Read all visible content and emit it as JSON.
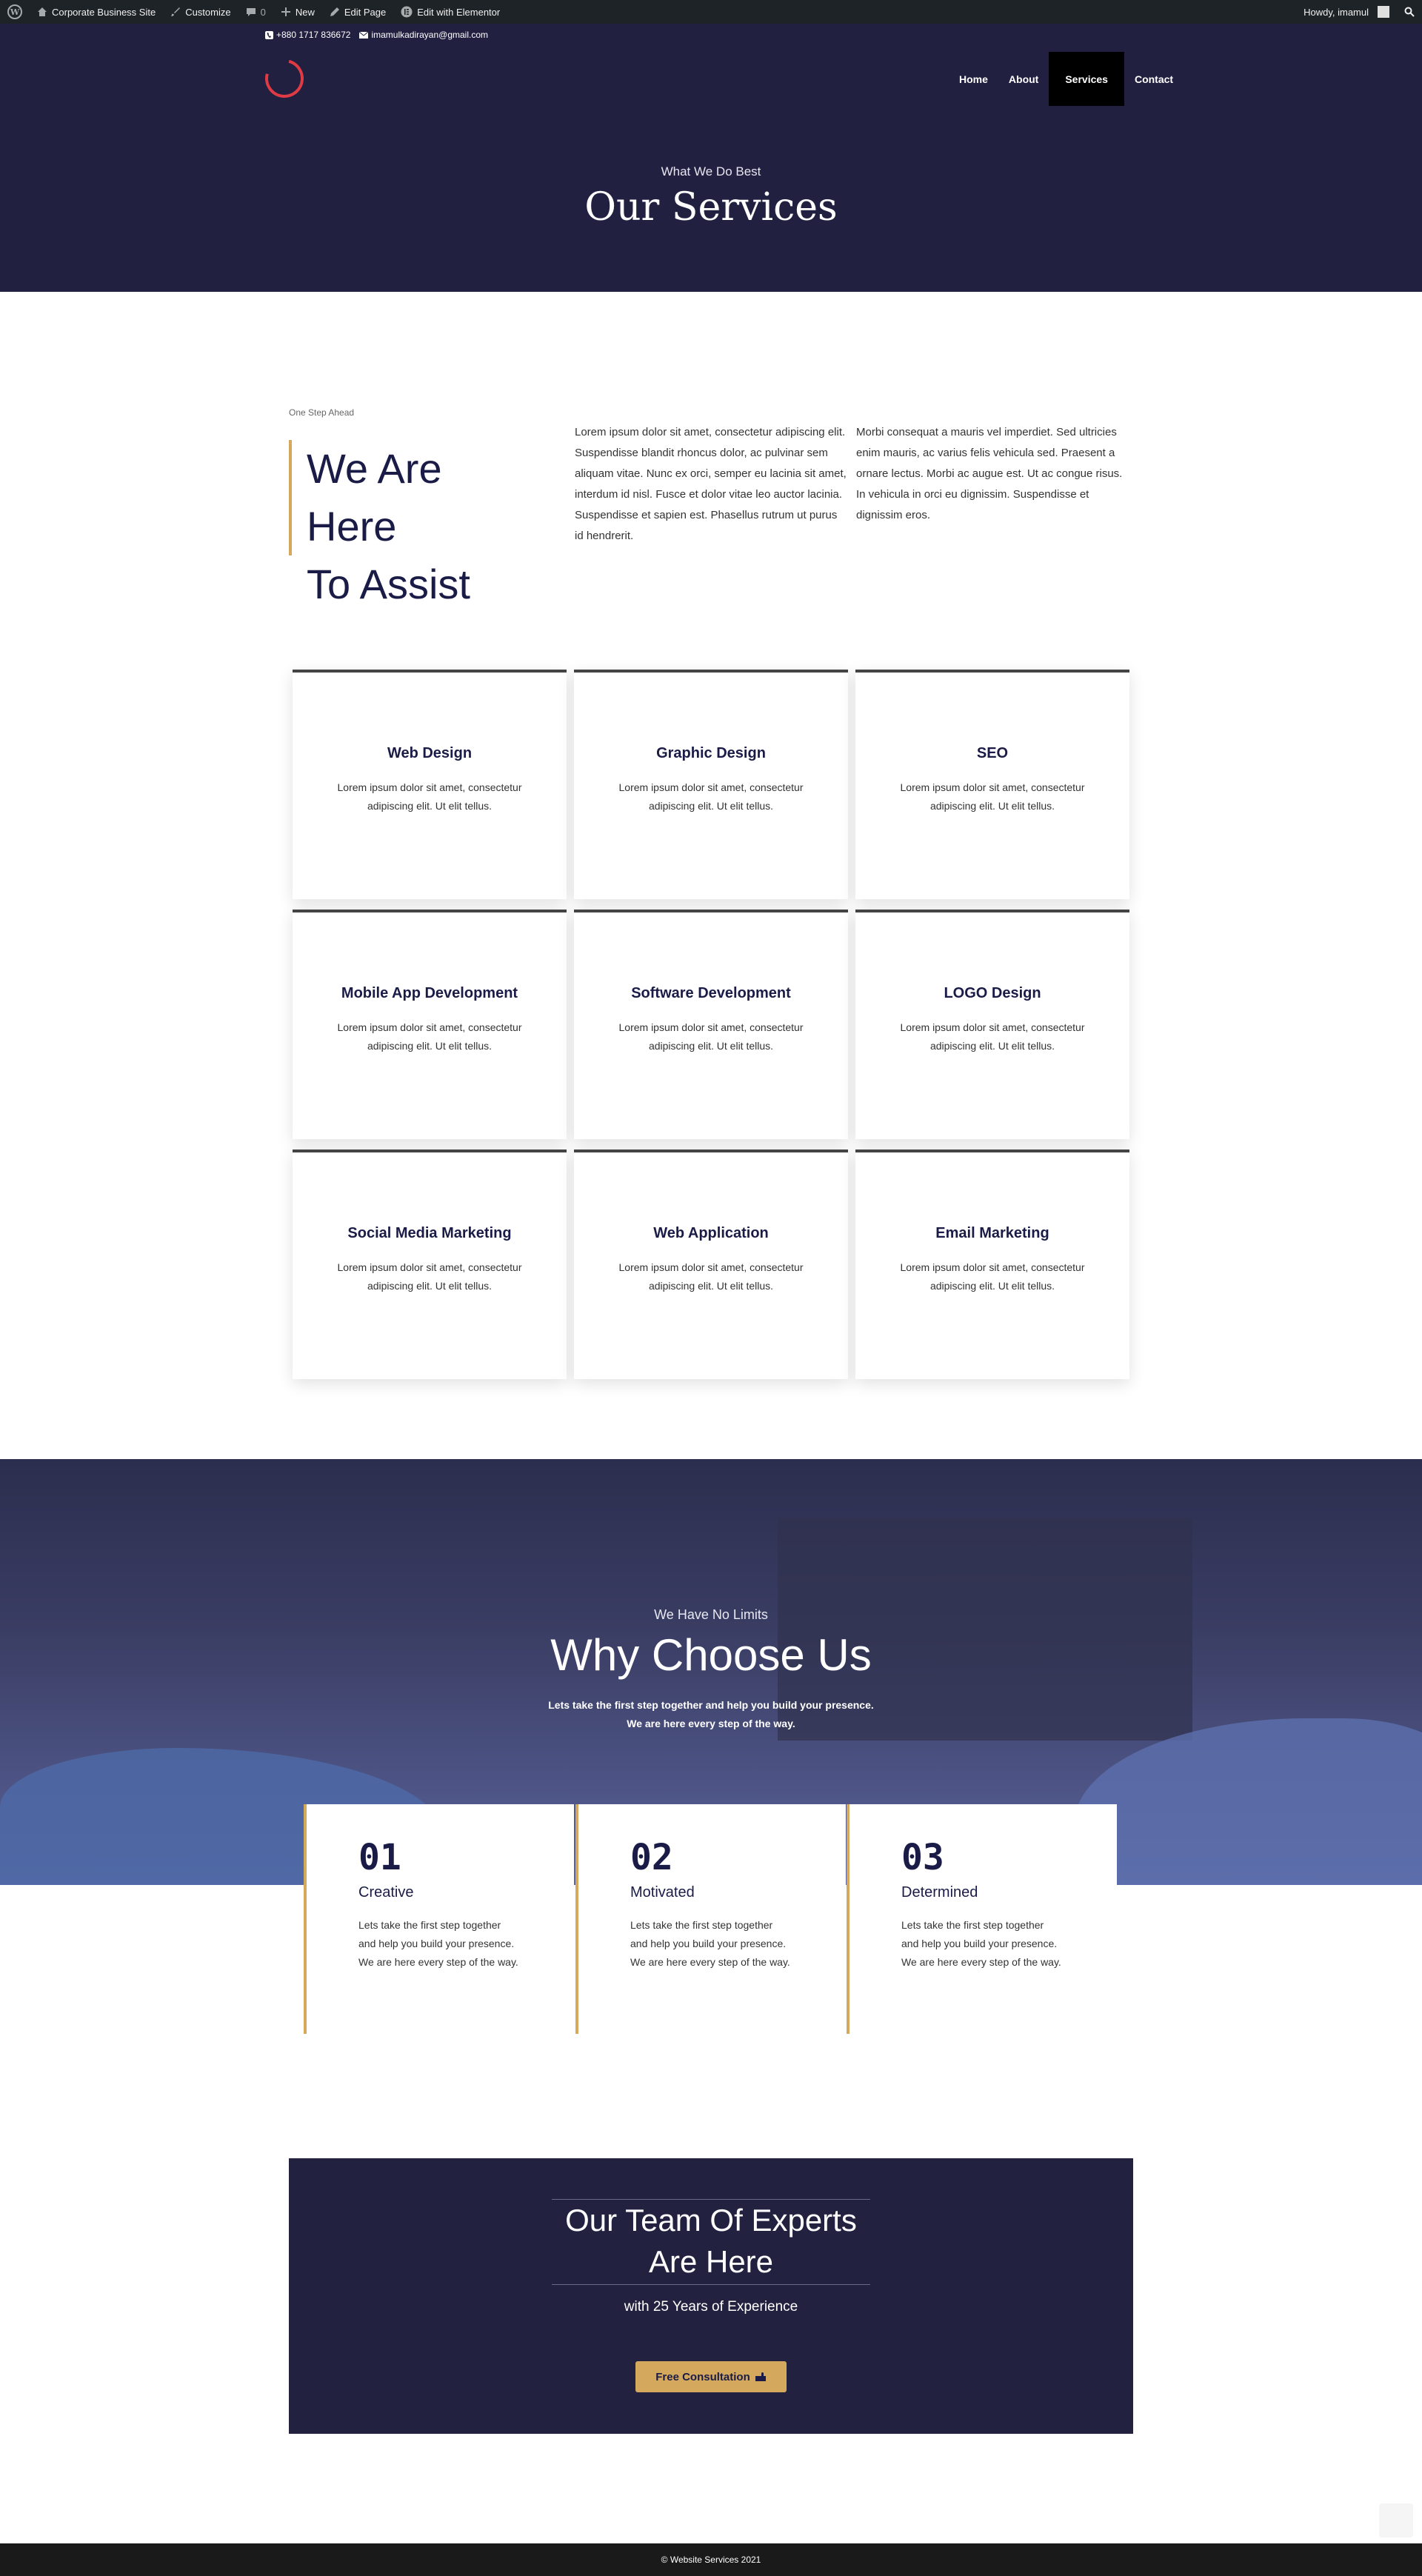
{
  "admin_bar": {
    "site_name": "Corporate Business Site",
    "customize": "Customize",
    "comments_count": "0",
    "new": "New",
    "edit_page": "Edit Page",
    "edit_elementor": "Edit with Elementor",
    "howdy": "Howdy, imamul"
  },
  "header": {
    "phone": "+880 1717 836672",
    "email": "imamulkadirayan@gmail.com",
    "nav": [
      "Home",
      "About",
      "Services",
      "Contact"
    ],
    "active_nav": "Services",
    "subtitle": "What We Do Best",
    "title": "Our Services"
  },
  "intro": {
    "kicker": "One Step Ahead",
    "heading_line1": "We Are Here",
    "heading_line2": "To Assist",
    "col1": "Lorem ipsum dolor sit amet, consectetur adipiscing elit. Suspendisse blandit rhoncus dolor, ac pulvinar sem aliquam vitae. Nunc ex orci, semper eu lacinia sit amet, interdum id nisl. Fusce et dolor vitae leo auctor lacinia. Suspendisse et sapien est. Phasellus rutrum ut purus id hendrerit.",
    "col2": "Morbi consequat a mauris vel imperdiet. Sed ultricies enim mauris, ac varius felis vehicula sed. Praesent a ornare lectus. Morbi ac augue est. Ut ac congue risus. In vehicula in orci eu dignissim. Suspendisse et dignissim eros."
  },
  "services": [
    {
      "title": "Web Design",
      "text": "Lorem ipsum dolor sit amet, consectetur adipiscing elit. Ut elit tellus."
    },
    {
      "title": "Graphic Design",
      "text": "Lorem ipsum dolor sit amet, consectetur adipiscing elit. Ut elit tellus."
    },
    {
      "title": "SEO",
      "text": "Lorem ipsum dolor sit amet, consectetur adipiscing elit. Ut elit tellus."
    },
    {
      "title": "Mobile App Development",
      "text": "Lorem ipsum dolor sit amet, consectetur adipiscing elit. Ut elit tellus."
    },
    {
      "title": "Software Development",
      "text": "Lorem ipsum dolor sit amet, consectetur adipiscing elit. Ut elit tellus."
    },
    {
      "title": "LOGO Design",
      "text": "Lorem ipsum dolor sit amet, consectetur adipiscing elit. Ut elit tellus."
    },
    {
      "title": "Social Media Marketing",
      "text": "Lorem ipsum dolor sit amet, consectetur adipiscing elit. Ut elit tellus."
    },
    {
      "title": "Web Application",
      "text": "Lorem ipsum dolor sit amet, consectetur adipiscing elit. Ut elit tellus."
    },
    {
      "title": "Email Marketing",
      "text": "Lorem ipsum dolor sit amet, consectetur adipiscing elit. Ut elit tellus."
    }
  ],
  "why": {
    "subtitle": "We Have No Limits",
    "title": "Why Choose Us",
    "text_line1": "Lets take the first step together and help you build your presence.",
    "text_line2": "We are here every step of the way.",
    "steps": [
      {
        "num": "01",
        "label": "Creative",
        "line1": "Lets take the first step together",
        "line2": "and help you build your presence.",
        "line3": "We are here every step of the way."
      },
      {
        "num": "02",
        "label": "Motivated",
        "line1": "Lets take the first step together",
        "line2": "and help you build your presence.",
        "line3": "We are here every step of the way."
      },
      {
        "num": "03",
        "label": "Determined",
        "line1": "Lets take the first step together",
        "line2": "and help you build your presence.",
        "line3": "We are here every step of the way."
      }
    ]
  },
  "team": {
    "title_line1": "Our Team Of Experts",
    "title_line2": "Are Here",
    "subtitle": "with 25 Years of Experience",
    "button": "Free Consultation"
  },
  "footer": {
    "copyright": "© Website Services 2021"
  },
  "colors": {
    "navy": "#212040",
    "gold": "#d4a95e",
    "heading": "#1a1c47",
    "logo_red": "#e03a45"
  }
}
